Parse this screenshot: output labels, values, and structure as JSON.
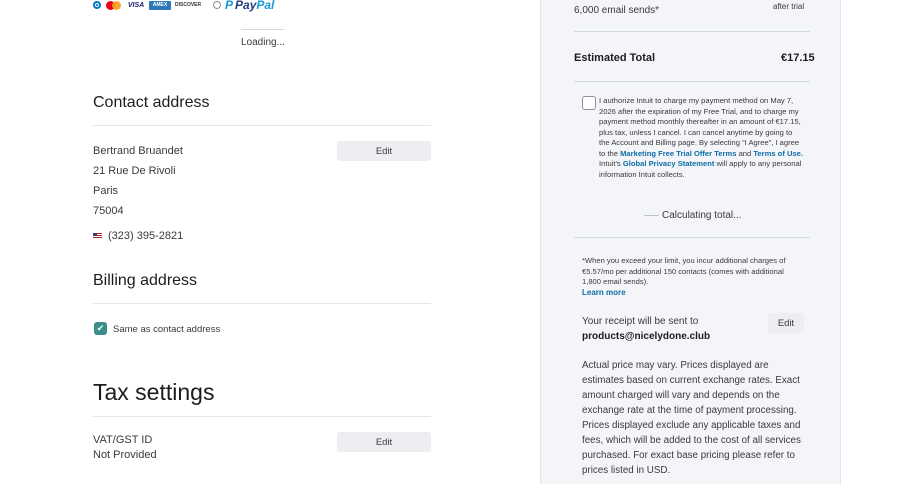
{
  "payment": {
    "paypal_label_pay": "Pay",
    "paypal_label_pal": "Pal",
    "loading_text": "Loading..."
  },
  "contact": {
    "heading": "Contact address",
    "name": "Bertrand Bruandet",
    "street": "21 Rue De Rivoli",
    "city": "Paris",
    "postal": "75004",
    "phone": "(323) 395-2821",
    "edit_label": "Edit"
  },
  "billing": {
    "heading": "Billing address",
    "same_as_label": "Same as contact address",
    "same_as_checked": true
  },
  "tax": {
    "heading": "Tax settings",
    "field_label": "VAT/GST ID",
    "field_value": "Not Provided",
    "edit_label": "Edit"
  },
  "summary": {
    "sends_label": "6,000 email sends*",
    "after_trial": "after trial",
    "estimated_total_label": "Estimated Total",
    "estimated_total_value": "€17.15",
    "auth_text_1": "I authorize Intuit to charge my payment method on May 7, 2026 after the expiration of my Free Trial, and to charge my payment method monthly thereafter in an amount of €17.15, plus tax, unless I cancel. I can cancel anytime by going to the Account and Billing page. By selecting “I Agree”, I agree to the ",
    "auth_link_1": "Marketing Free Trial Offer Terms",
    "auth_text_2": " and ",
    "auth_link_2": "Terms of Use.",
    "auth_text_3": " Intuit's ",
    "auth_link_3": "Global Privacy Statement",
    "auth_text_4": " will apply to any personal information Intuit collects.",
    "calculating_text": "Calculating total...",
    "limit_text": "*When you exceed your limit, you incur additional charges of €5.57/mo per additional 150 contacts (comes with additional 1,800 email sends).",
    "learn_more": "Learn more",
    "receipt_text": "Your receipt will be sent to",
    "receipt_email": "products@nicelydone.club",
    "receipt_edit": "Edit",
    "price_note": "Actual price may vary. Prices displayed are estimates based on current exchange rates. Exact amount charged will vary and depends on the exchange rate at the time of payment processing. Prices displayed exclude any applicable taxes and fees, which will be added to the cost of all services purchased. For exact base pricing please refer to prices listed in USD."
  },
  "colors": {
    "link": "#0d6ea8",
    "checkbox": "#3a8f8a",
    "panel_bg": "#f4f5f8"
  }
}
